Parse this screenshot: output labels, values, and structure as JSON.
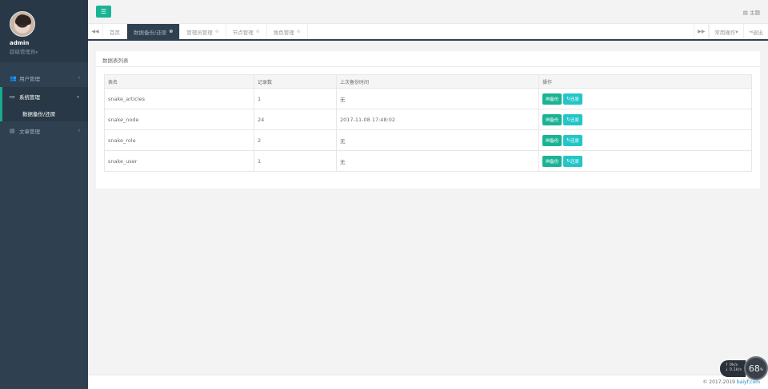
{
  "profile": {
    "name": "admin",
    "role": "超级管理员"
  },
  "sidebar": {
    "items": [
      {
        "label": "用户管理",
        "icon": "users-icon"
      },
      {
        "label": "系统管理",
        "icon": "desktop-icon"
      },
      {
        "label": "数据备份/还原"
      },
      {
        "label": "文章管理",
        "icon": "book-icon"
      }
    ]
  },
  "topbar": {
    "menu_icon": "☰",
    "theme_label": "主题"
  },
  "tabs": {
    "items": [
      {
        "label": "首页"
      },
      {
        "label": "数据备份/还原"
      },
      {
        "label": "管理员管理"
      },
      {
        "label": "节点管理"
      },
      {
        "label": "角色管理"
      }
    ],
    "common_ops": "常用操作",
    "logout": "退出"
  },
  "panel": {
    "title": "数据表列表",
    "columns": [
      "表名",
      "记录数",
      "上次备份时间",
      "操作"
    ],
    "rows": [
      {
        "name": "snake_articles",
        "count": "1",
        "last_backup": "无"
      },
      {
        "name": "snake_node",
        "count": "24",
        "last_backup": "2017-11-08 17:48:02"
      },
      {
        "name": "snake_role",
        "count": "2",
        "last_backup": "无"
      },
      {
        "name": "snake_user",
        "count": "1",
        "last_backup": "无"
      }
    ],
    "backup_label": "备份",
    "restore_label": "还原"
  },
  "footer": {
    "copyright": "© 2017-2019",
    "site": "baiyf.com"
  },
  "netwidget": {
    "up": "0k/s",
    "down": "0.1k/s",
    "percent": "68",
    "percent_unit": "%"
  },
  "colors": {
    "sidebar": "#2f4050",
    "primary": "#1ab394",
    "info": "#23c6c8"
  }
}
